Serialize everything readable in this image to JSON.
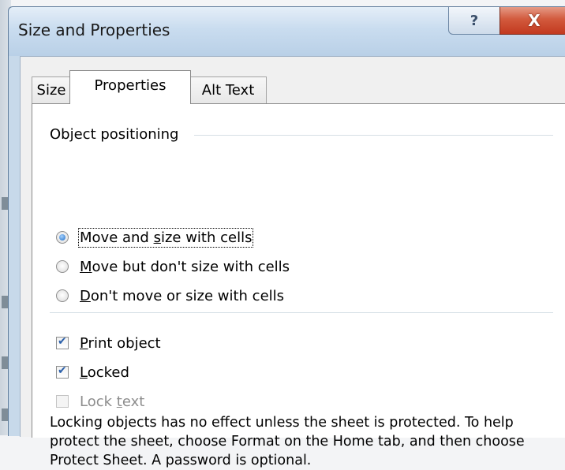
{
  "window": {
    "title": "Size and Properties"
  },
  "title_buttons": {
    "help": "?",
    "close": "X"
  },
  "tabs": [
    {
      "label": "Size",
      "active": false
    },
    {
      "label": "Properties",
      "active": true
    },
    {
      "label": "Alt Text",
      "active": false
    }
  ],
  "positioning": {
    "group_label": "Object positioning",
    "options": [
      {
        "pre": "Move and ",
        "key": "s",
        "post": "ize with cells",
        "selected": true
      },
      {
        "pre": "",
        "key": "M",
        "post": "ove but don't size with cells",
        "selected": false
      },
      {
        "pre": "",
        "key": "D",
        "post": "on't move or size with cells",
        "selected": false
      }
    ]
  },
  "checkboxes": [
    {
      "pre": "",
      "key": "P",
      "post": "rint object",
      "checked": true,
      "enabled": true
    },
    {
      "pre": "",
      "key": "L",
      "post": "ocked",
      "checked": true,
      "enabled": true
    },
    {
      "pre": "Lock ",
      "key": "t",
      "post": "ext",
      "checked": false,
      "enabled": false
    }
  ],
  "description": "Locking objects has no effect unless the sheet is protected. To help protect the sheet, choose Format on the Home tab, and then choose Protect Sheet. A password is optional.",
  "colors": {
    "accent": "#1e6bc4",
    "close_button": "#c2391f",
    "title_bar": "#c9dcef"
  }
}
